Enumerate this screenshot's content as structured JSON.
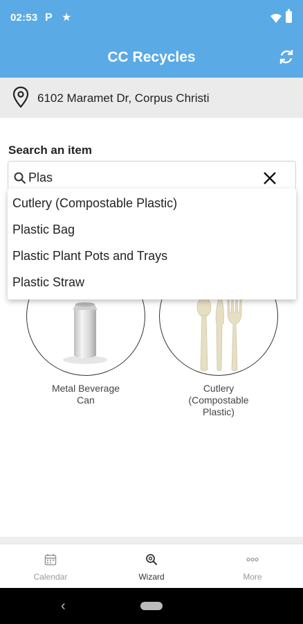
{
  "status": {
    "time": "02:53",
    "p_glyph": "P",
    "star_glyph": "★"
  },
  "app": {
    "title": "CC Recycles",
    "refresh_icon": "refresh-icon"
  },
  "location": {
    "address": "6102 Maramet Dr, Corpus Christi",
    "icon": "map-pin-icon"
  },
  "search": {
    "label": "Search an item",
    "value": "Plas",
    "icon": "search-icon",
    "clear_icon": "close-icon"
  },
  "suggestions": [
    "Cutlery (Compostable Plastic)",
    "Plastic Bag",
    "Plastic Plant Pots and Trays",
    "Plastic Straw"
  ],
  "items": [
    {
      "label": "Metal Beverage Can",
      "icon": "metal-can-image"
    },
    {
      "label": "Cutlery (Compostable Plastic)",
      "icon": "cutlery-image"
    }
  ],
  "nav": {
    "tabs": [
      {
        "label": "Calendar",
        "icon": "calendar-icon",
        "active": false
      },
      {
        "label": "Wizard",
        "icon": "wizard-search-icon",
        "active": true
      },
      {
        "label": "More",
        "icon": "more-dots-icon",
        "active": false
      }
    ]
  },
  "system_nav": {
    "back_glyph": "‹"
  },
  "colors": {
    "primary": "#5aaae6",
    "location_bg": "#ebebeb",
    "text": "#222222"
  }
}
